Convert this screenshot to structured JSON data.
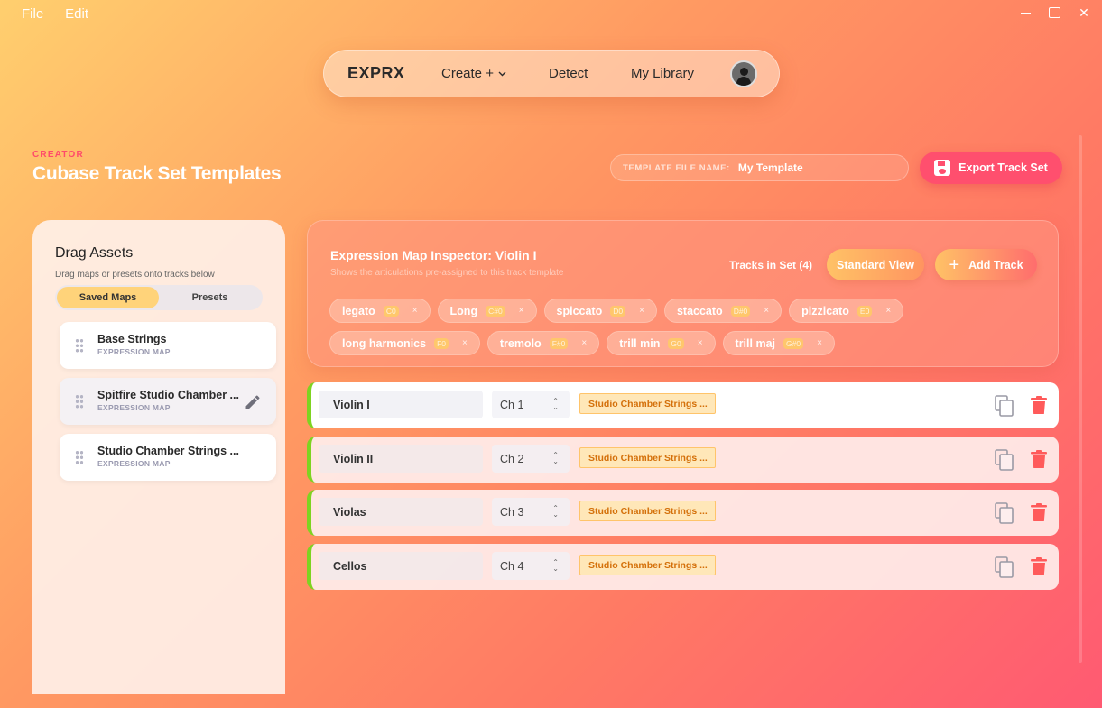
{
  "menu": {
    "file": "File",
    "edit": "Edit"
  },
  "nav": {
    "brand": "EXPRX",
    "create": "Create +",
    "detect": "Detect",
    "library": "My Library"
  },
  "header": {
    "kicker": "CREATOR",
    "title": "Cubase Track Set Templates",
    "file_name_label": "TEMPLATE FILE NAME:",
    "file_name_value": "My Template",
    "export_label": "Export Track Set"
  },
  "assets": {
    "title": "Drag Assets",
    "subtitle": "Drag maps or presets onto tracks below",
    "tabs": [
      "Saved Maps",
      "Presets"
    ],
    "items": [
      {
        "name": "Base Strings",
        "type": "EXPRESSION MAP"
      },
      {
        "name": "Spitfire Studio Chamber ...",
        "type": "EXPRESSION MAP"
      },
      {
        "name": "Studio Chamber Strings ...",
        "type": "EXPRESSION MAP"
      }
    ]
  },
  "inspector": {
    "title": "Expression Map Inspector: Violin I",
    "subtitle": "Shows the articulations pre-assigned to this track template",
    "tracks_count": "Tracks in Set (4)",
    "standard_view": "Standard View",
    "add_track": "Add Track",
    "articulations": [
      {
        "name": "legato",
        "key": "C0"
      },
      {
        "name": "Long",
        "key": "C#0"
      },
      {
        "name": "spiccato",
        "key": "D0"
      },
      {
        "name": "staccato",
        "key": "D#0"
      },
      {
        "name": "pizzicato",
        "key": "E0"
      },
      {
        "name": "long harmonics",
        "key": "F0"
      },
      {
        "name": "tremolo",
        "key": "F#0"
      },
      {
        "name": "trill min",
        "key": "G0"
      },
      {
        "name": "trill maj",
        "key": "G#0"
      }
    ]
  },
  "tracks": [
    {
      "name": "Violin I",
      "channel": "Ch 1",
      "map": "Studio Chamber Strings ..."
    },
    {
      "name": "Violin II",
      "channel": "Ch 2",
      "map": "Studio Chamber Strings ..."
    },
    {
      "name": "Violas",
      "channel": "Ch 3",
      "map": "Studio Chamber Strings ..."
    },
    {
      "name": "Cellos",
      "channel": "Ch 4",
      "map": "Studio Chamber Strings ..."
    }
  ],
  "colors": {
    "accent": "#ff4f6e",
    "track_marker": "#7ed321",
    "map_tag": "#d4700a"
  }
}
